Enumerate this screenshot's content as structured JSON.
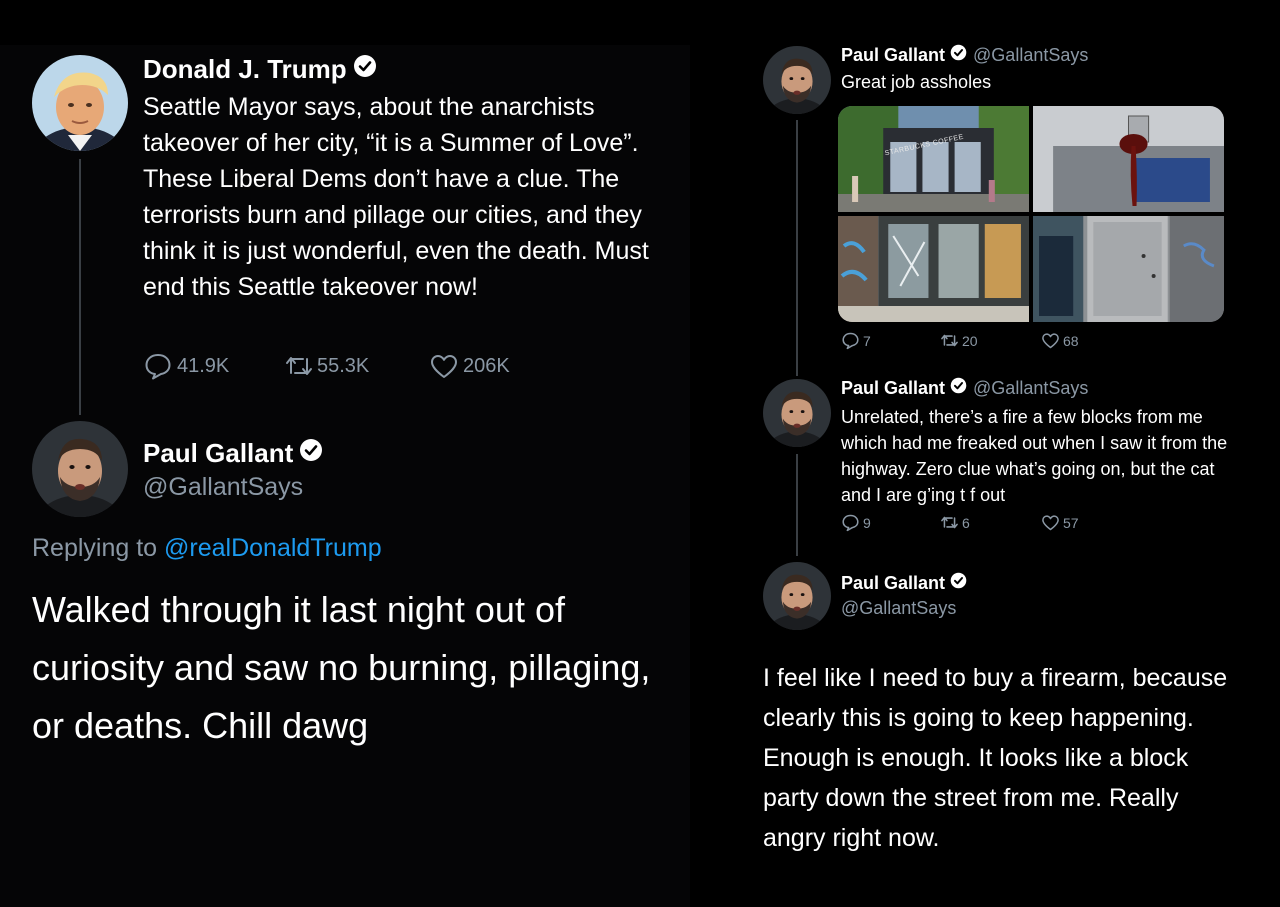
{
  "left": {
    "trump_tweet": {
      "name": "Donald J. Trump",
      "text": "Seattle Mayor says, about the anarchists takeover of her city, “it is a Summer of Love”. These Liberal Dems don’t have a clue. The terrorists burn and pillage our cities, and they think it is just wonderful, even the death. Must end this Seattle takeover now!",
      "reply_count": "41.9K",
      "retweet_count": "55.3K",
      "like_count": "206K"
    },
    "gallant_reply": {
      "name": "Paul Gallant",
      "handle": "@GallantSays",
      "replying_prefix": "Replying to",
      "replying_handle": "@realDonaldTrump",
      "text": "Walked through it last night out of curiosity and saw no burning, pillaging, or deaths. Chill dawg"
    }
  },
  "right": {
    "tweet1": {
      "name": "Paul Gallant",
      "handle": "@GallantSays",
      "text": "Great job assholes",
      "image_sign_text": "STARBUCKS COFFEE",
      "reply_count": "7",
      "retweet_count": "20",
      "like_count": "68"
    },
    "tweet2": {
      "name": "Paul Gallant",
      "handle": "@GallantSays",
      "text": "Unrelated, there’s a fire a few blocks from me which had me freaked out when I saw it from the highway. Zero clue what’s going on, but the cat and I are g’ing t f out",
      "reply_count": "9",
      "retweet_count": "6",
      "like_count": "57"
    },
    "tweet3": {
      "name": "Paul Gallant",
      "handle": "@GallantSays",
      "text": "I feel like I need to buy a firearm, because clearly this is going to keep happening. Enough is enough. It looks like a block party down the street from me. Really angry right now."
    }
  },
  "colors": {
    "background": "#000000",
    "muted_text": "#8b98a5",
    "link": "#1d9bf0",
    "thread_line": "#3a3f44"
  }
}
